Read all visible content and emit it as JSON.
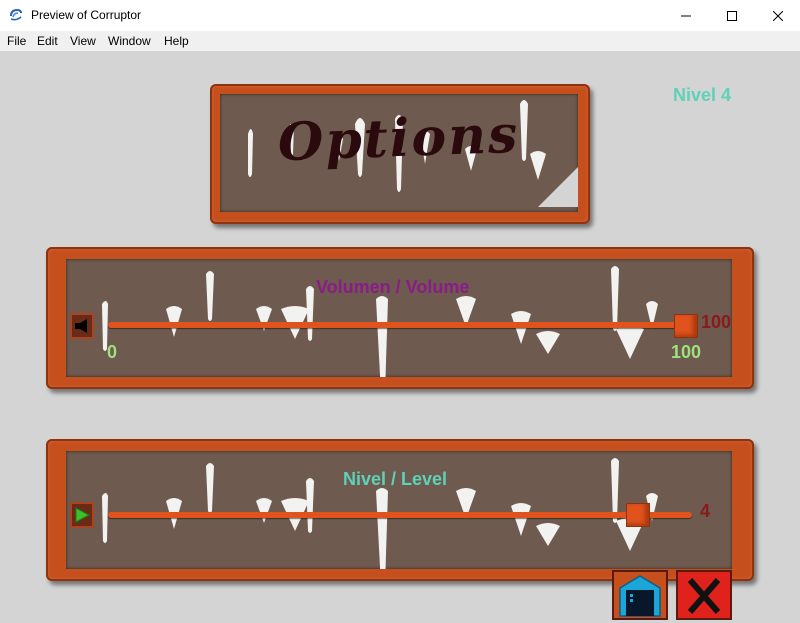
{
  "window": {
    "title": "Preview of Corruptor",
    "app_icon": "corruptor-swirl-icon",
    "controls": [
      "minimize-icon",
      "maximize-icon",
      "close-icon"
    ]
  },
  "menu": {
    "items": [
      "File",
      "Edit",
      "View",
      "Window",
      "Help"
    ]
  },
  "game": {
    "level_indicator": "Nivel 4",
    "options_title": "Options",
    "volume": {
      "label": "Volumen / Volume",
      "icon": "speaker-icon",
      "min_label": "0",
      "max_label": "100",
      "current_label": "100",
      "value": 100,
      "min": 0,
      "max": 100
    },
    "level": {
      "label": "Nivel / Level",
      "icon": "play-icon",
      "current_label": "4",
      "value": 4,
      "fraction": 0.92
    },
    "buttons": {
      "home_icon": "home-icon",
      "close_icon": "red-x-icon"
    }
  },
  "colors": {
    "frame": "#c54f1d",
    "panel_bg": "#6e5a4e",
    "slider": "#e0531d",
    "teal_text": "#5ed1b8",
    "purple_text": "#8b1a8a",
    "green_text": "#9fe07f",
    "value_text": "#8b1a1a"
  }
}
